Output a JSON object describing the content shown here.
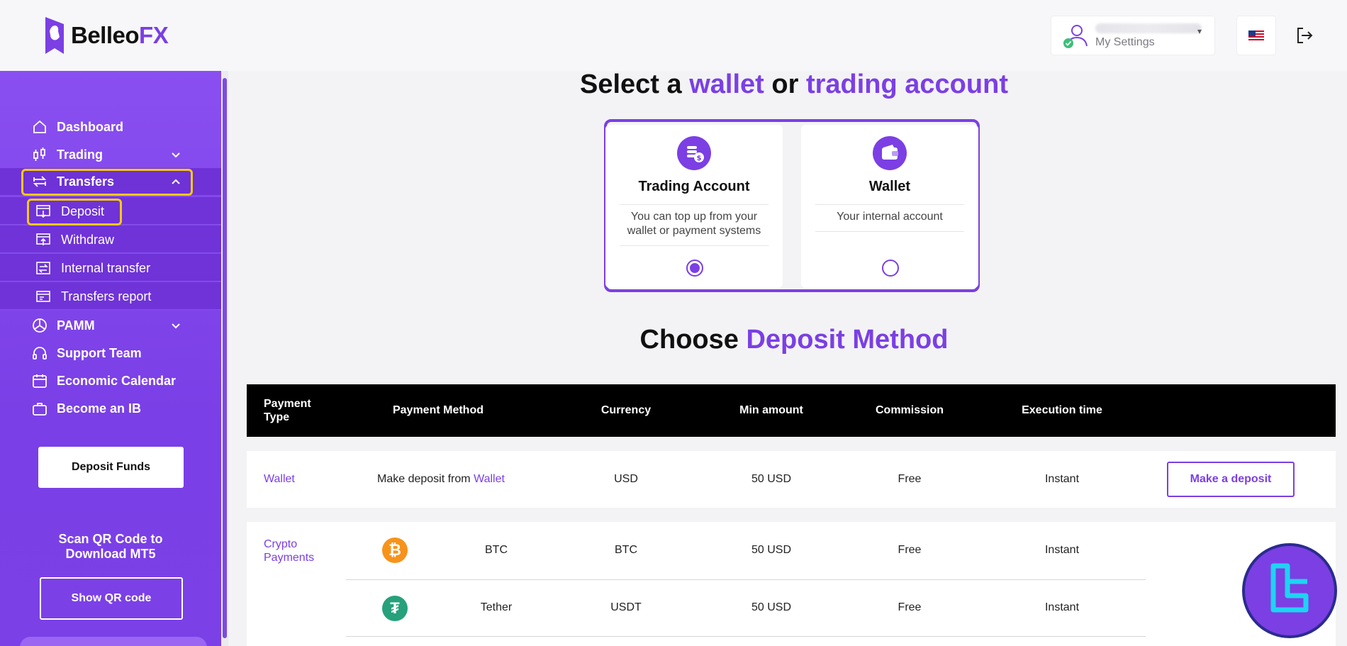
{
  "header": {
    "logo_text_main": "Belleo",
    "logo_text_accent": "FX",
    "user_settings_label": "My Settings",
    "language_flag": "us-flag-icon",
    "logout_icon": "logout-icon"
  },
  "sidebar": {
    "items": [
      {
        "label": "Dashboard",
        "icon": "home-icon"
      },
      {
        "label": "Trading",
        "icon": "candlestick-icon",
        "expandable": true
      },
      {
        "label": "Transfers",
        "icon": "transfer-icon",
        "expandable": true,
        "expanded": true
      },
      {
        "label": "PAMM",
        "icon": "pie-icon",
        "expandable": true
      },
      {
        "label": "Support Team",
        "icon": "headset-icon"
      },
      {
        "label": "Economic Calendar",
        "icon": "calendar-icon"
      },
      {
        "label": "Become an IB",
        "icon": "briefcase-icon"
      }
    ],
    "transfers_sub": [
      {
        "label": "Deposit",
        "icon": "deposit-icon"
      },
      {
        "label": "Withdraw",
        "icon": "withdraw-icon"
      },
      {
        "label": "Internal transfer",
        "icon": "internal-transfer-icon"
      },
      {
        "label": "Transfers report",
        "icon": "report-icon"
      }
    ],
    "deposit_funds_label": "Deposit Funds",
    "qr_line1": "Scan QR Code to",
    "qr_line2": "Download MT5",
    "show_qr_label": "Show QR code"
  },
  "main": {
    "select_prefix": "Select a",
    "select_wallet": "wallet",
    "select_or": "or",
    "select_trading": "trading account",
    "cards": [
      {
        "title": "Trading Account",
        "desc": "You can top up from your wallet or payment systems",
        "selected": true
      },
      {
        "title": "Wallet",
        "desc": "Your internal account",
        "selected": false
      }
    ],
    "choose_prefix": "Choose",
    "choose_accent": "Deposit Method",
    "table": {
      "headers": {
        "payment_type": "Payment Type",
        "payment_method": "Payment Method",
        "currency": "Currency",
        "min_amount": "Min amount",
        "commission": "Commission",
        "execution_time": "Execution time"
      },
      "wallet_row": {
        "type": "Wallet",
        "method_prefix": "Make deposit from",
        "method_link": "Wallet",
        "currency": "USD",
        "min_amount": "50 USD",
        "commission": "Free",
        "execution": "Instant",
        "action": "Make a deposit"
      },
      "crypto_type_line1": "Crypto",
      "crypto_type_line2": "Payments",
      "crypto_rows": [
        {
          "method": "BTC",
          "icon": "bitcoin-icon",
          "currency": "BTC",
          "min_amount": "50 USD",
          "commission": "Free",
          "execution": "Instant"
        },
        {
          "method": "Tether",
          "icon": "tether-icon",
          "currency": "USDT",
          "min_amount": "50 USD",
          "commission": "Free",
          "execution": "Instant"
        }
      ]
    }
  },
  "colors": {
    "brand": "#7b3fe4",
    "highlight": "#f6c915",
    "bitcoin": "#f7931a",
    "tether": "#26a17b"
  }
}
